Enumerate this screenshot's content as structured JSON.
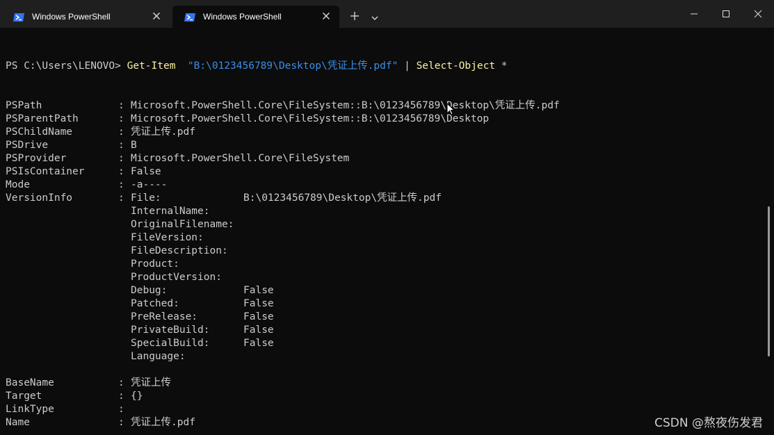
{
  "window": {
    "tabs": [
      {
        "title": "Windows PowerShell",
        "active": false
      },
      {
        "title": "Windows PowerShell",
        "active": true
      }
    ],
    "new_tab_symbol": "+",
    "icons": {
      "tab": "powershell-icon",
      "close": "close-icon",
      "new_tab": "plus-icon",
      "dropdown": "chevron-down-icon",
      "minimize": "minimize-icon",
      "maximize": "maximize-icon",
      "window_close": "window-close-icon"
    }
  },
  "colors": {
    "background": "#0c0c0c",
    "titlebar": "#1f1f1f",
    "text": "#cccccc",
    "command": "#f9f1a5",
    "string": "#3b8eea",
    "powershell_blue": "#3574f0"
  },
  "command": {
    "prompt": "PS C:\\Users\\LENOVO> ",
    "cmdlet": "Get-Item",
    "argument": "\"B:\\0123456789\\Desktop\\凭证上传.pdf\"",
    "pipe": "|",
    "cmdlet2": "Select-Object",
    "arg2": "*"
  },
  "properties": [
    {
      "name": "PSPath",
      "value": "Microsoft.PowerShell.Core\\FileSystem::B:\\0123456789\\Desktop\\凭证上传.pdf"
    },
    {
      "name": "PSParentPath",
      "value": "Microsoft.PowerShell.Core\\FileSystem::B:\\0123456789\\Desktop"
    },
    {
      "name": "PSChildName",
      "value": "凭证上传.pdf"
    },
    {
      "name": "PSDrive",
      "value": "B"
    },
    {
      "name": "PSProvider",
      "value": "Microsoft.PowerShell.Core\\FileSystem"
    },
    {
      "name": "PSIsContainer",
      "value": "False"
    },
    {
      "name": "Mode",
      "value": "-a----"
    }
  ],
  "version_info": {
    "name": "VersionInfo",
    "entries": [
      {
        "key": "File:",
        "value": "B:\\0123456789\\Desktop\\凭证上传.pdf"
      },
      {
        "key": "InternalName:",
        "value": ""
      },
      {
        "key": "OriginalFilename:",
        "value": ""
      },
      {
        "key": "FileVersion:",
        "value": ""
      },
      {
        "key": "FileDescription:",
        "value": ""
      },
      {
        "key": "Product:",
        "value": ""
      },
      {
        "key": "ProductVersion:",
        "value": ""
      },
      {
        "key": "Debug:",
        "value": "False"
      },
      {
        "key": "Patched:",
        "value": "False"
      },
      {
        "key": "PreRelease:",
        "value": "False"
      },
      {
        "key": "PrivateBuild:",
        "value": "False"
      },
      {
        "key": "SpecialBuild:",
        "value": "False"
      },
      {
        "key": "Language:",
        "value": ""
      }
    ]
  },
  "properties2": [
    {
      "name": "BaseName",
      "value": "凭证上传"
    },
    {
      "name": "Target",
      "value": "{}"
    },
    {
      "name": "LinkType",
      "value": ""
    },
    {
      "name": "Name",
      "value": "凭证上传.pdf"
    }
  ],
  "separator": ":",
  "watermark": "CSDN @熬夜伤发君"
}
